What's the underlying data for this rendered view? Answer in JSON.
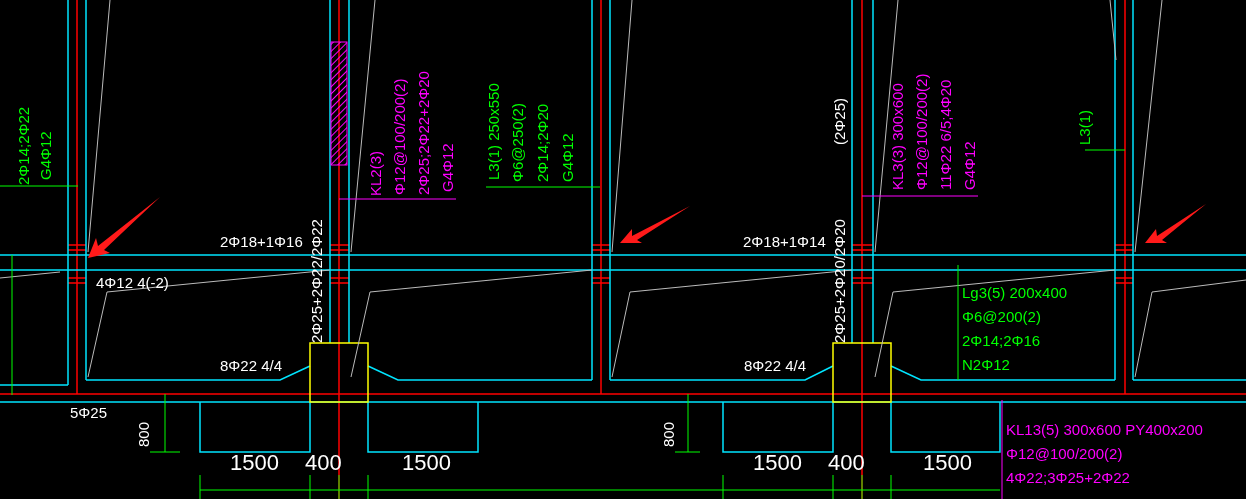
{
  "labels": [
    {
      "text": "2Φ14;2Φ22",
      "color": "#00ff00",
      "kind": "vertical"
    },
    {
      "text": "G4Φ12",
      "color": "#00ff00",
      "kind": "vertical"
    },
    {
      "text": "KL2(3)",
      "color": "#ff00ff",
      "kind": "vertical"
    },
    {
      "text": "Φ12@100/200(2)",
      "color": "#ff00ff",
      "kind": "vertical"
    },
    {
      "text": "2Φ25;2Φ22+2Φ20",
      "color": "#ff00ff",
      "kind": "vertical"
    },
    {
      "text": "G4Φ12",
      "color": "#ff00ff",
      "kind": "vertical"
    },
    {
      "text": "L3(1) 250x550",
      "color": "#00ff00",
      "kind": "vertical"
    },
    {
      "text": "Φ6@250(2)",
      "color": "#00ff00",
      "kind": "vertical"
    },
    {
      "text": "2Φ14;2Φ20",
      "color": "#00ff00",
      "kind": "vertical"
    },
    {
      "text": "G4Φ12",
      "color": "#00ff00",
      "kind": "vertical"
    },
    {
      "text": "(2Φ25)",
      "color": "#ffffff",
      "kind": "vertical"
    },
    {
      "text": "KL3(3) 300x600",
      "color": "#ff00ff",
      "kind": "vertical"
    },
    {
      "text": "Φ12@100/200(2)",
      "color": "#ff00ff",
      "kind": "vertical"
    },
    {
      "text": "11Φ22 6/5;4Φ20",
      "color": "#ff00ff",
      "kind": "vertical"
    },
    {
      "text": "G4Φ12",
      "color": "#ff00ff",
      "kind": "vertical"
    },
    {
      "text": "L3(1)",
      "color": "#00ff00",
      "kind": "vertical"
    },
    {
      "text": "2Φ18+1Φ16",
      "color": "#ffffff",
      "kind": "horizontal"
    },
    {
      "text": "2Φ25+2Φ22/2Φ22",
      "color": "#ffffff",
      "kind": "vertical"
    },
    {
      "text": "2Φ18+1Φ14",
      "color": "#ffffff",
      "kind": "horizontal"
    },
    {
      "text": "2Φ25+2Φ20/2Φ20",
      "color": "#ffffff",
      "kind": "vertical"
    },
    {
      "text": "4Φ12 4(-2)",
      "color": "#ffffff",
      "kind": "horizontal"
    },
    {
      "text": "Lg3(5) 200x400",
      "color": "#00ff00",
      "kind": "horizontal"
    },
    {
      "text": "Φ6@200(2)",
      "color": "#00ff00",
      "kind": "horizontal"
    },
    {
      "text": "2Φ14;2Φ16",
      "color": "#00ff00",
      "kind": "horizontal"
    },
    {
      "text": "8Φ22 4/4",
      "color": "#ffffff",
      "kind": "horizontal"
    },
    {
      "text": "8Φ22 4/4",
      "color": "#ffffff",
      "kind": "horizontal"
    },
    {
      "text": "N2Φ12",
      "color": "#00ff00",
      "kind": "horizontal"
    },
    {
      "text": "5Φ25",
      "color": "#ffffff",
      "kind": "horizontal"
    },
    {
      "text": "800",
      "color": "#ffffff",
      "kind": "vertical"
    },
    {
      "text": "800",
      "color": "#ffffff",
      "kind": "vertical"
    },
    {
      "text": "KL13(5) 300x600 PY400x200",
      "color": "#ff00ff",
      "kind": "horizontal"
    },
    {
      "text": "Φ12@100/200(2)",
      "color": "#ff00ff",
      "kind": "horizontal"
    },
    {
      "text": "4Φ22;3Φ25+2Φ22",
      "color": "#ff00ff",
      "kind": "horizontal"
    },
    {
      "text": "1500",
      "color": "#ffffff",
      "kind": "dimension"
    },
    {
      "text": "400",
      "color": "#ffffff",
      "kind": "dimension"
    },
    {
      "text": "1500",
      "color": "#ffffff",
      "kind": "dimension"
    },
    {
      "text": "1500",
      "color": "#ffffff",
      "kind": "dimension"
    },
    {
      "text": "400",
      "color": "#ffffff",
      "kind": "dimension"
    },
    {
      "text": "1500",
      "color": "#ffffff",
      "kind": "dimension"
    }
  ]
}
